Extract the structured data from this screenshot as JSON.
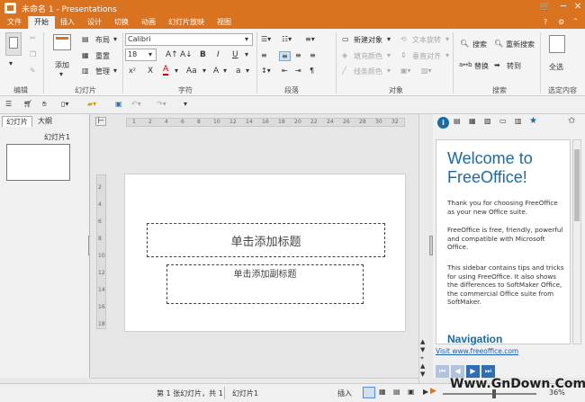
{
  "title": "未命名 1 - Presentations",
  "menu_tabs": [
    "文件",
    "开始",
    "插入",
    "设计",
    "切换",
    "动画",
    "幻灯片放映",
    "视图"
  ],
  "ribbon": {
    "paste": "粘贴",
    "add": "添加",
    "layout": "布局",
    "reset": "重置",
    "manage": "管理",
    "font_name": "Calibri",
    "font_size": "18",
    "new_object": "新建对象",
    "text_rotate": "文本旋转",
    "fill_color": "填充颜色",
    "valign": "垂直对齐",
    "line_color": "线条颜色",
    "search": "搜索",
    "replace_search": "重新搜索",
    "replace": "替换",
    "goto": "转到",
    "select_all": "全选",
    "groups": {
      "edit": "编辑",
      "slides": "幻灯片",
      "font": "字符",
      "paragraph": "段落",
      "object": "对象",
      "search": "搜索",
      "select": "选定内容"
    }
  },
  "left_tabs": [
    "幻灯片",
    "大纲"
  ],
  "slide_label": "幻灯片1",
  "slide": {
    "title_placeholder": "单击添加标题",
    "subtitle_placeholder": "单击添加副标题"
  },
  "ruler_h": [
    "1",
    "2",
    "4",
    "6",
    "8",
    "10",
    "12",
    "14",
    "16",
    "18",
    "20",
    "22",
    "24",
    "26",
    "28",
    "30",
    "32"
  ],
  "ruler_v": [
    "2",
    "4",
    "6",
    "8",
    "10",
    "12",
    "14",
    "16",
    "18"
  ],
  "sidebar": {
    "heading": "Welcome to FreeOffice!",
    "p1": "Thank you for choosing FreeOffice as your new Office suite.",
    "p2": "FreeOffice is free, friendly, powerful and compatible with Microsoft Office.",
    "p3": "This sidebar contains tips and tricks for using FreeOffice. It also shows the differences to SoftMaker Office, the commercial Office suite from SoftMaker.",
    "nav": "Navigation",
    "link": "Visit www.freeoffice.com"
  },
  "status": {
    "slide_info": "第 1 张幻灯片，共 1",
    "slide_name": "幻灯片1",
    "mode": "插入",
    "zoom": "36%"
  },
  "watermark": "Www.GnDown.Com",
  "colors": {
    "accent": "#d9731f",
    "link": "#1a5fb4",
    "heading": "#1a6aa8"
  }
}
